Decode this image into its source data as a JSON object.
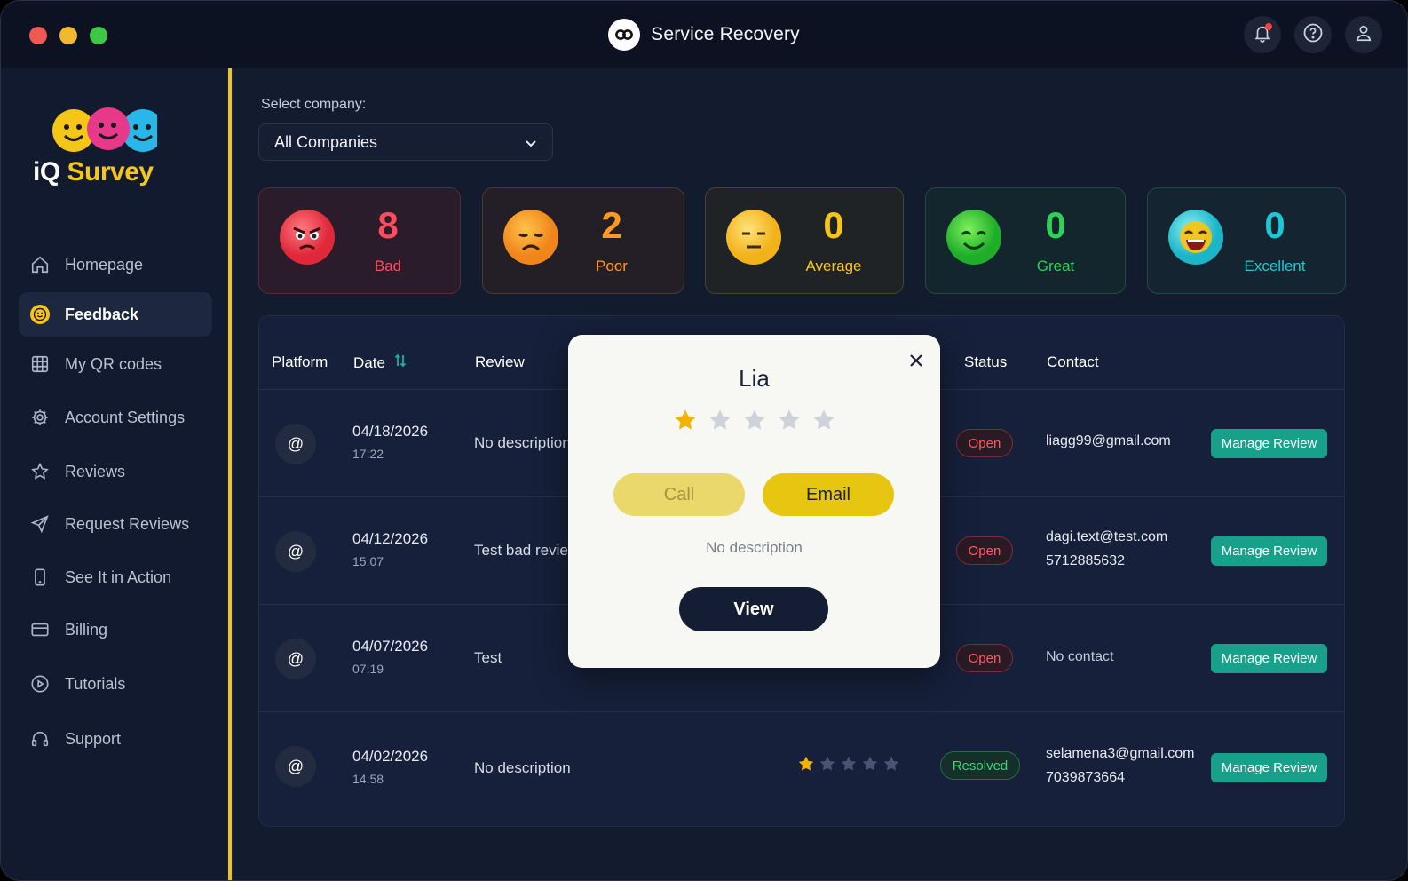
{
  "app": {
    "title": "Service Recovery"
  },
  "colors": {
    "accent": "#f0c419",
    "teal": "#17a08a",
    "open": "#ff5a5f",
    "resolved": "#42d17a",
    "star": "#f5b301"
  },
  "logo": {
    "prefix": "iQ ",
    "word": "Survey"
  },
  "sidebar": {
    "items": [
      {
        "label": "Homepage",
        "icon": "home-icon"
      },
      {
        "label": "Feedback",
        "icon": "smiley-icon",
        "active": true
      },
      {
        "label": "My QR codes",
        "icon": "qr-grid-icon"
      },
      {
        "label": "Account Settings",
        "icon": "gear-icon"
      },
      {
        "label": "Reviews",
        "icon": "star-icon"
      },
      {
        "label": "Request Reviews",
        "icon": "send-icon"
      },
      {
        "label": "See It in Action",
        "icon": "phone-icon"
      },
      {
        "label": "Billing",
        "icon": "credit-card-icon"
      },
      {
        "label": "Tutorials",
        "icon": "play-icon"
      },
      {
        "label": "Support",
        "icon": "headphones-icon"
      }
    ]
  },
  "company": {
    "label": "Select company:",
    "selected": "All Companies"
  },
  "stats": [
    {
      "count": "8",
      "label": "Bad",
      "color": "#ff4d5e"
    },
    {
      "count": "2",
      "label": "Poor",
      "color": "#ff9a1f"
    },
    {
      "count": "0",
      "label": "Average",
      "color": "#f5c518"
    },
    {
      "count": "0",
      "label": "Great",
      "color": "#2fd15a"
    },
    {
      "count": "0",
      "label": "Excellent",
      "color": "#1fc6d4"
    }
  ],
  "table": {
    "headers": {
      "platform": "Platform",
      "date": "Date",
      "review": "Review",
      "status": "Status",
      "contact": "Contact"
    },
    "rows": [
      {
        "platform": "@",
        "date": "04/18/2026",
        "time": "17:22",
        "review": "No description",
        "status": "Open",
        "contact_line1": "liagg99@gmail.com",
        "contact_line2": "",
        "action": "Manage Review"
      },
      {
        "platform": "@",
        "date": "04/12/2026",
        "time": "15:07",
        "review": "Test bad review",
        "status": "Open",
        "contact_line1": "dagi.text@test.com",
        "contact_line2": "5712885632",
        "action": "Manage Review"
      },
      {
        "platform": "@",
        "date": "04/07/2026",
        "time": "07:19",
        "review": "Test",
        "status": "Open",
        "contact_line1": "No contact",
        "contact_line2": "",
        "action": "Manage Review"
      },
      {
        "platform": "@",
        "date": "04/02/2026",
        "time": "14:58",
        "review": "No description",
        "status": "Resolved",
        "rating": 1,
        "contact_line1": "selamena3@gmail.com",
        "contact_line2": "7039873664",
        "action": "Manage Review"
      }
    ]
  },
  "modal": {
    "name": "Lia",
    "rating": 1,
    "max_rating": 5,
    "call_label": "Call",
    "email_label": "Email",
    "description": "No description",
    "view_label": "View"
  }
}
